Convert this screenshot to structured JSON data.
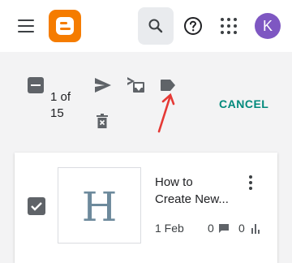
{
  "header": {
    "avatar_initial": "K",
    "icons": [
      "menu-icon",
      "blogger-logo",
      "search-icon",
      "help-icon",
      "apps-icon"
    ],
    "colors": {
      "logo": "#f57c00",
      "avatar": "#7e57c2"
    }
  },
  "action_bar": {
    "selection_count": "1 of 15",
    "selection_line1": "1 of",
    "selection_line2": "15",
    "cancel_label": "CANCEL",
    "icons": [
      "deselect-icon",
      "publish-icon",
      "revert-to-draft-icon",
      "label-icon",
      "delete-icon"
    ],
    "accent_color": "#00897b"
  },
  "post": {
    "thumbnail_letter": "H",
    "title": "How to Create New...",
    "title_line1": "How to",
    "title_line2": "Create New...",
    "date": "1 Feb",
    "comments": "0",
    "views": "0",
    "checked": true
  },
  "annotations": {
    "arrow_color": "#e53935"
  }
}
